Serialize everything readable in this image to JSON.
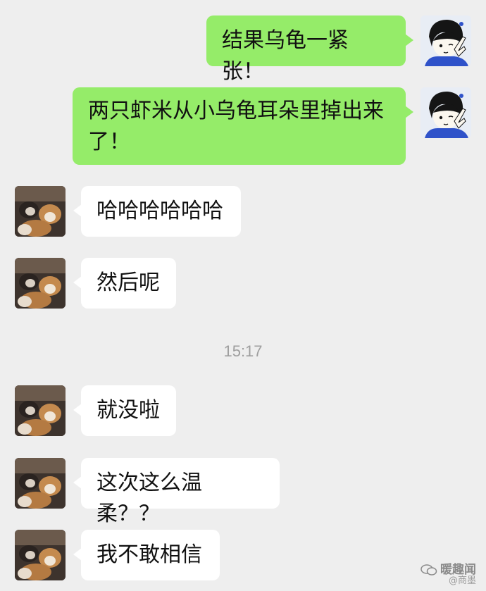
{
  "chat": {
    "messages": [
      {
        "side": "sent",
        "text": "结果乌龟一紧张！",
        "avatar": "girl-avatar"
      },
      {
        "side": "sent",
        "text": "两只虾米从小乌龟耳朵里掉出来了！",
        "avatar": "girl-avatar"
      },
      {
        "side": "received",
        "text": "哈哈哈哈哈哈",
        "avatar": "pets-avatar"
      },
      {
        "side": "received",
        "text": "然后呢",
        "avatar": "pets-avatar"
      },
      {
        "side": "received",
        "text": "就没啦",
        "avatar": "pets-avatar"
      },
      {
        "side": "received",
        "text": "这次这么温柔？？",
        "avatar": "pets-avatar"
      },
      {
        "side": "received",
        "text": "我不敢相信",
        "avatar": "pets-avatar"
      }
    ],
    "timestamp": "15:17"
  },
  "watermark": {
    "account": "暖趣闻",
    "sub": "@商墨"
  },
  "colors": {
    "background": "#eeeeee",
    "sent_bubble": "#95ec69",
    "received_bubble": "#ffffff",
    "timestamp": "#9e9e9e"
  }
}
